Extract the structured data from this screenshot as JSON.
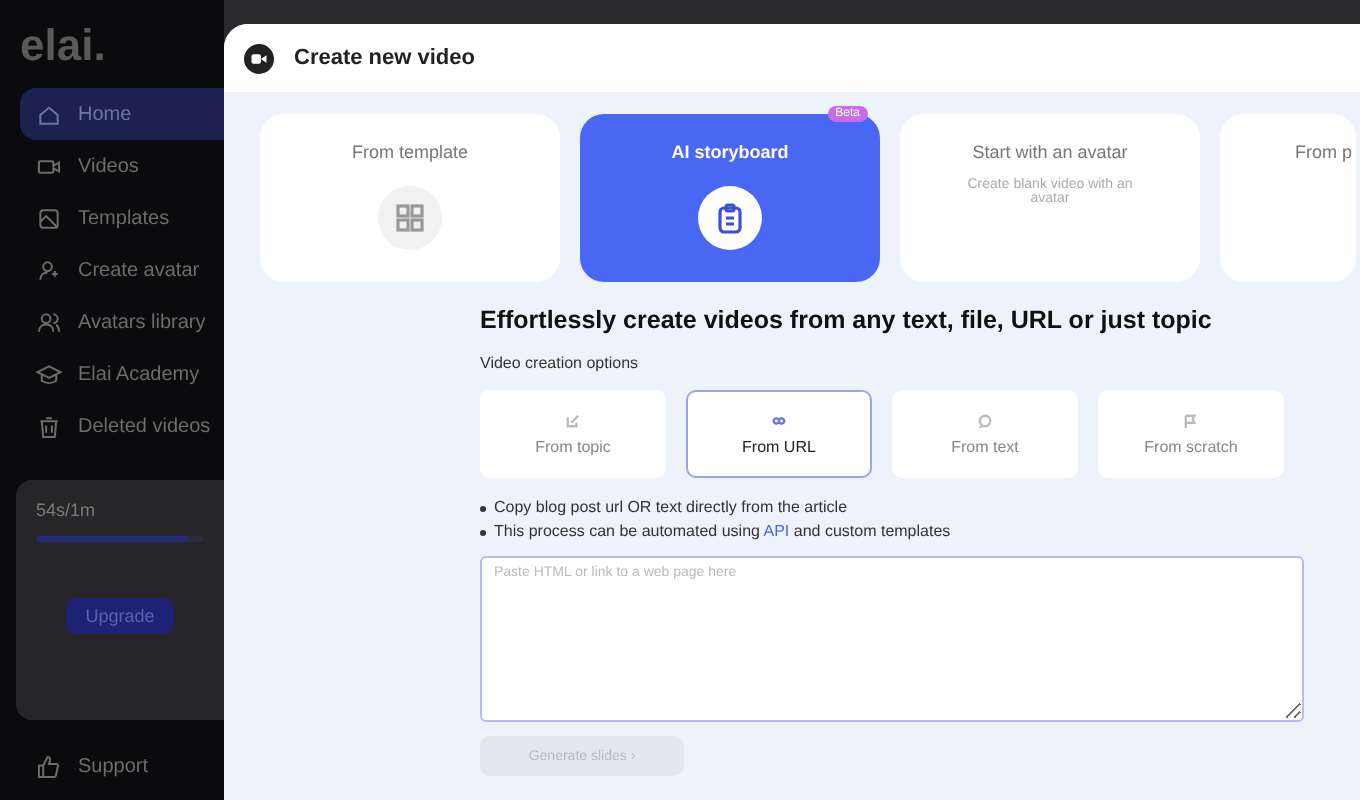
{
  "sidebar": {
    "logo": "elai.",
    "items": [
      {
        "label": "Home",
        "selected": true
      },
      {
        "label": "Videos",
        "selected": false
      },
      {
        "label": "Templates",
        "selected": false
      },
      {
        "label": "Create avatar",
        "selected": false
      },
      {
        "label": "Avatars library",
        "selected": false
      },
      {
        "label": "Elai Academy",
        "selected": false
      },
      {
        "label": "Deleted videos",
        "selected": false
      }
    ],
    "plan": {
      "usage": "54s/1m",
      "level": 0.9,
      "button": "Upgrade"
    },
    "support": "Support"
  },
  "modal": {
    "title": "Create new video",
    "cards": [
      {
        "title": "From template",
        "selected": false
      },
      {
        "title": "AI storyboard",
        "selected": true,
        "badge": "Beta"
      },
      {
        "title": "Start with an avatar",
        "subtitle": "Create blank video with an avatar",
        "selected": false
      },
      {
        "title": "From p",
        "selected": false
      }
    ],
    "heading": "Effortlessly create videos from any text, file, URL or just topic",
    "options_label": "Video creation options",
    "options": [
      {
        "label": "From topic",
        "selected": false
      },
      {
        "label": "From URL",
        "selected": true
      },
      {
        "label": "From text",
        "selected": false
      },
      {
        "label": "From scratch",
        "selected": false
      }
    ],
    "bullets": [
      {
        "text": "Copy blog post url OR text directly from the article"
      },
      {
        "text": "This process can be automated using",
        "link": "API",
        "after": "and custom templates"
      }
    ],
    "input": {
      "placeholder": "Paste HTML or link to a web page here"
    },
    "generate_button": {
      "label": "Generate slides ›",
      "disabled": true
    }
  }
}
